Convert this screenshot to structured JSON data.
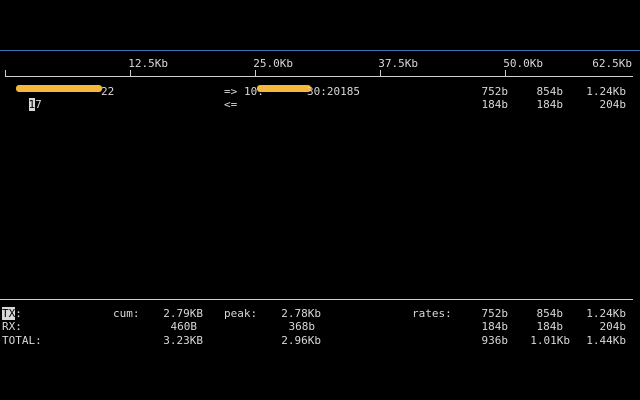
{
  "colors": {
    "background": "#000000",
    "text": "#d8d8d8",
    "top_border": "#3a6fb0",
    "scale_line": "#cfcfcf",
    "redaction": "#f5b83d"
  },
  "scale": {
    "labels": [
      "12.5Kb",
      "25.0Kb",
      "37.5Kb",
      "50.0Kb",
      "62.5Kb"
    ]
  },
  "connection": {
    "src_first_char": "1",
    "src_visible_1": "7",
    "src_tail": "22",
    "arrow_out": "=>",
    "dst_prefix": "10.",
    "dst_visible": "30:20185",
    "arrow_in": "<=",
    "rates_tx": [
      "752b",
      "854b",
      "1.24Kb"
    ],
    "rates_rx": [
      "184b",
      "184b",
      "204b"
    ]
  },
  "footer": {
    "tx_label_cursor": "TX",
    "tx_label_rest": ":",
    "rx_label": "RX:",
    "total_label": "TOTAL:",
    "cum_label": "cum:",
    "peak_label": "peak:",
    "rates_label": "rates:",
    "tx_cum": "2.79KB",
    "rx_cum": "460B",
    "total_cum": "3.23KB",
    "tx_peak": "2.78Kb",
    "rx_peak": "368b",
    "total_peak": "2.96Kb",
    "tx_rates": [
      "752b",
      "854b",
      "1.24Kb"
    ],
    "rx_rates": [
      "184b",
      "184b",
      "204b"
    ],
    "total_rates": [
      "936b",
      "1.01Kb",
      "1.44Kb"
    ]
  }
}
